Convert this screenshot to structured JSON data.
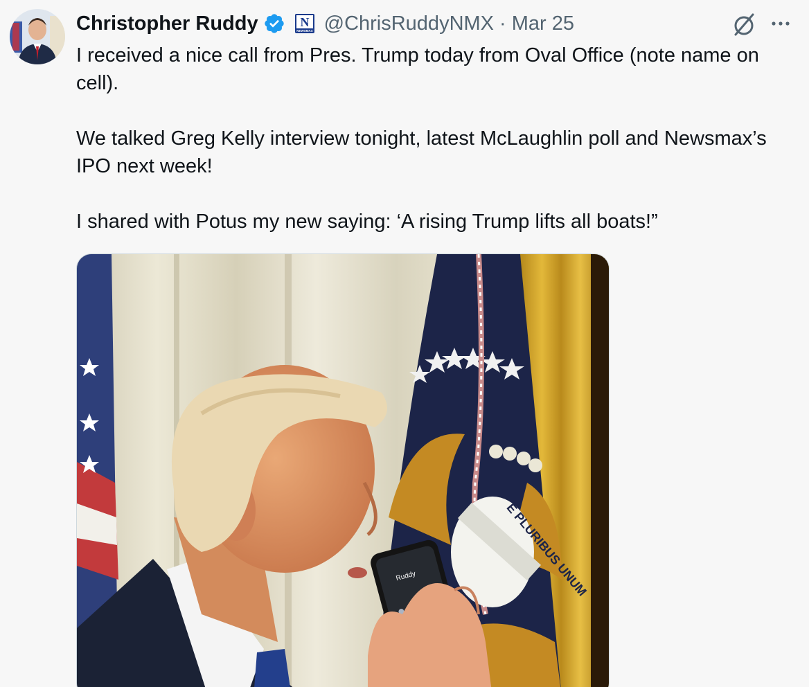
{
  "author": {
    "display_name": "Christopher Ruddy",
    "handle": "@ChrisRuddyNMX",
    "separator": "·",
    "date": "Mar 25",
    "verified_badge": "verified-check-icon",
    "affiliation_badge": "newsmax-logo-icon",
    "affiliation_letter": "N",
    "affiliation_word": "NEWSMAX",
    "avatar_icon": "profile-photo"
  },
  "tweet": {
    "paragraphs": [
      "I received a nice call from Pres. Trump today from Oval Office (note name on cell).",
      "We talked Greg Kelly interview tonight, latest McLaughlin poll and Newsmax’s IPO next week!",
      "I shared with Potus my new saying: ‘A rising Trump lifts all boats!”"
    ]
  },
  "media": {
    "phone_caller_name": "Ruddy",
    "seal_motto": "E PLURIBUS UNUM"
  },
  "icons": {
    "grok": "grok-icon",
    "more": "more-options-icon"
  },
  "colors": {
    "accent": "#1d9bf0",
    "text": "#0f1419",
    "secondary": "#536471",
    "background": "#f7f7f7"
  }
}
